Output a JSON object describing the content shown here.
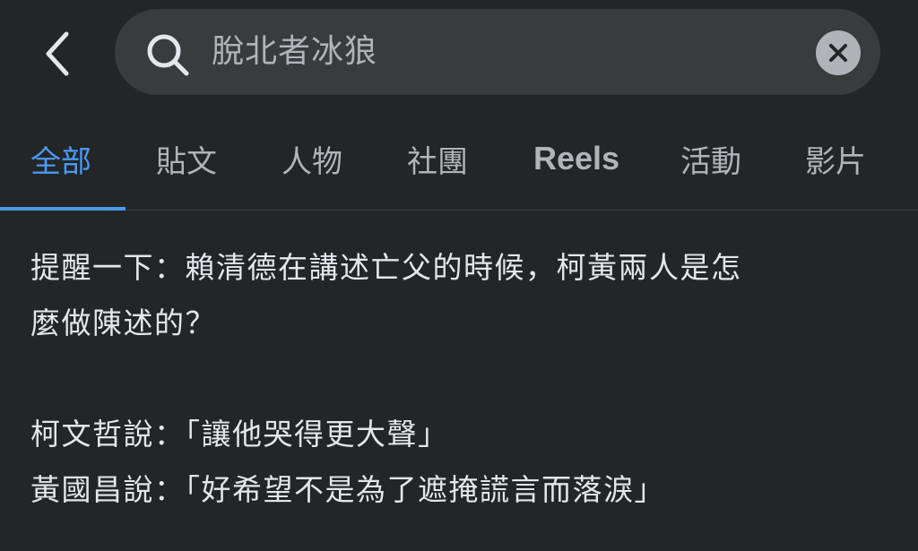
{
  "header": {
    "back_icon": "chevron-left-icon",
    "search": {
      "value": "脫北者冰狼",
      "icon": "search-icon",
      "clear_icon": "close-icon"
    }
  },
  "tabs": [
    {
      "label": "全部",
      "active": true
    },
    {
      "label": "貼文",
      "active": false
    },
    {
      "label": "人物",
      "active": false
    },
    {
      "label": "社團",
      "active": false
    },
    {
      "label": "Reels",
      "active": false
    },
    {
      "label": "活動",
      "active": false
    },
    {
      "label": "影片",
      "active": false
    }
  ],
  "post": {
    "line1": "提醒一下：賴清德在講述亡父的時候，柯黃兩人是怎",
    "line2": "麼做陳述的？",
    "line3": "柯文哲說：「讓他哭得更大聲」",
    "line4": "黃國昌說：「好希望不是為了遮掩謊言而落淚」"
  },
  "colors": {
    "background": "#242526",
    "search_bg": "#3a3b3c",
    "accent": "#4a9af5",
    "text_primary": "#e4e6eb",
    "text_secondary": "#b0b3b8"
  }
}
